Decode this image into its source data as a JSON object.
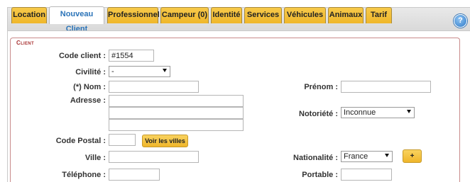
{
  "tabs": [
    {
      "label": "Location"
    },
    {
      "label": "Nouveau Client"
    },
    {
      "label": "Professionnel"
    },
    {
      "label": "Campeur (0)"
    },
    {
      "label": "Identité"
    },
    {
      "label": "Services"
    },
    {
      "label": "Véhicules"
    },
    {
      "label": "Animaux"
    },
    {
      "label": "Tarif"
    }
  ],
  "active_tab": "Nouveau Client",
  "help_icon": "?",
  "section": {
    "legend": "Client"
  },
  "form": {
    "code_client": {
      "label": "Code client :",
      "value": "#1554"
    },
    "civilite": {
      "label": "Civilité :",
      "value": "-"
    },
    "nom": {
      "label": "(*) Nom :",
      "value": ""
    },
    "prenom": {
      "label": "Prénom :",
      "value": ""
    },
    "adresse": {
      "label": "Adresse :",
      "lines": [
        "",
        "",
        ""
      ]
    },
    "notoriete": {
      "label": "Notoriété :",
      "value": "Inconnue"
    },
    "code_postal": {
      "label": "Code Postal :",
      "value": ""
    },
    "voir_villes": {
      "label": "Voir les villes"
    },
    "ville": {
      "label": "Ville :",
      "value": ""
    },
    "nationalite": {
      "label": "Nationalité :",
      "value": "France"
    },
    "add_nationalite": {
      "label": "+"
    },
    "telephone": {
      "label": "Téléphone :",
      "value": ""
    },
    "portable": {
      "label": "Portable :",
      "value": ""
    }
  },
  "colors": {
    "tab_bg": "#efb72b",
    "active_tab_text": "#2a73b8",
    "legend": "#a83232",
    "fieldset_border": "#c98a8a"
  }
}
